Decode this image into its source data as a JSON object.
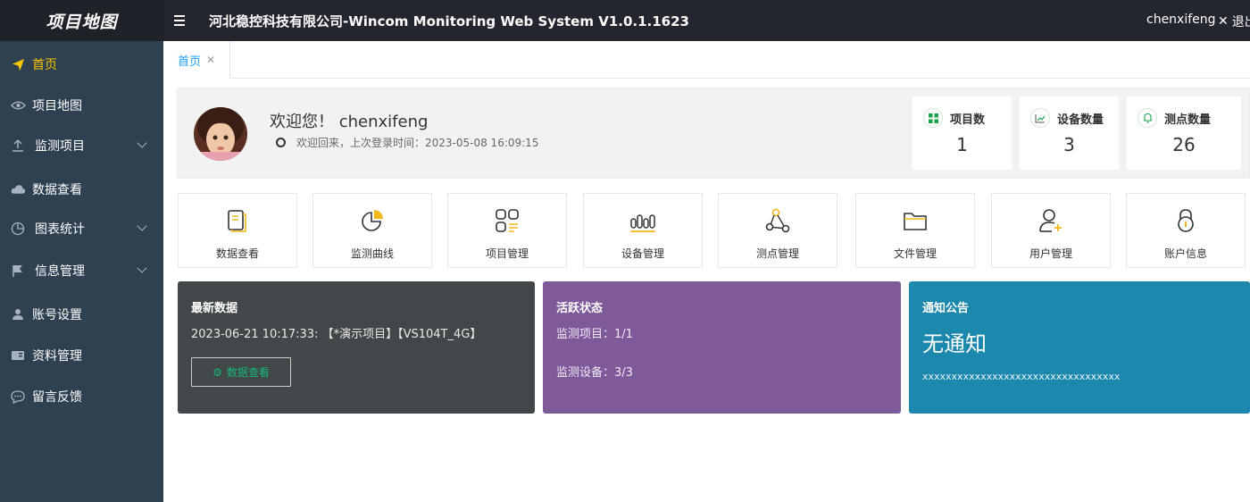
{
  "header": {
    "logo": "项目地图",
    "title": "河北稳控科技有限公司-Wincom Monitoring Web System V1.0.1.1623",
    "user": "chenxifeng",
    "logout": "退出"
  },
  "sidebar": {
    "items": [
      {
        "label": "首页",
        "icon": "send-icon",
        "active": true
      },
      {
        "label": "项目地图",
        "icon": "eye-icon"
      },
      {
        "label": "监测项目",
        "icon": "upload-icon",
        "expandable": true
      },
      {
        "label": "数据查看",
        "icon": "cloud-icon"
      },
      {
        "label": "图表统计",
        "icon": "pie-chart-icon",
        "expandable": true
      },
      {
        "label": "信息管理",
        "icon": "flag-icon",
        "expandable": true
      },
      {
        "label": "账号设置",
        "icon": "user-icon"
      },
      {
        "label": "资料管理",
        "icon": "id-card-icon"
      },
      {
        "label": "留言反馈",
        "icon": "chat-bubble-icon"
      }
    ]
  },
  "tabs": [
    {
      "label": "首页",
      "closable": true
    }
  ],
  "welcome": {
    "greeting": "欢迎您！ chenxifeng",
    "last_login": "欢迎回来，上次登录时间：2023-05-08 16:09:15"
  },
  "stats": [
    {
      "label": "项目数",
      "value": "1",
      "icon": "grid-icon"
    },
    {
      "label": "设备数量",
      "value": "3",
      "icon": "chart-icon"
    },
    {
      "label": "测点数量",
      "value": "26",
      "icon": "bell-icon"
    }
  ],
  "quick_links": [
    {
      "label": "数据查看",
      "icon": "document-icon"
    },
    {
      "label": "监测曲线",
      "icon": "pie-chart-icon"
    },
    {
      "label": "项目管理",
      "icon": "apps-icon"
    },
    {
      "label": "设备管理",
      "icon": "bar-chart-icon"
    },
    {
      "label": "测点管理",
      "icon": "nodes-icon"
    },
    {
      "label": "文件管理",
      "icon": "folder-icon"
    },
    {
      "label": "用户管理",
      "icon": "user-add-icon"
    },
    {
      "label": "账户信息",
      "icon": "lock-icon"
    }
  ],
  "panels": {
    "latest": {
      "title": "最新数据",
      "line": "2023-06-21 10:17:33: 【*演示项目】【VS104T_4G】",
      "button": "数据查看"
    },
    "activity": {
      "title": "活跃状态",
      "projects": "监测项目：1/1",
      "devices": "监测设备：3/3"
    },
    "notice": {
      "title": "通知公告",
      "big": "无通知",
      "small": "xxxxxxxxxxxxxxxxxxxxxxxxxxxxxxxxxx"
    }
  },
  "colors": {
    "topbar": "#23262e",
    "sidebar": "#2f4050",
    "active": "#f7c600",
    "tab_active": "#1e9fff",
    "icon_accent": "#f2b718",
    "panel_dark": "#42484a",
    "panel_purple": "#7e5a9a",
    "panel_blue": "#1c88ad"
  }
}
